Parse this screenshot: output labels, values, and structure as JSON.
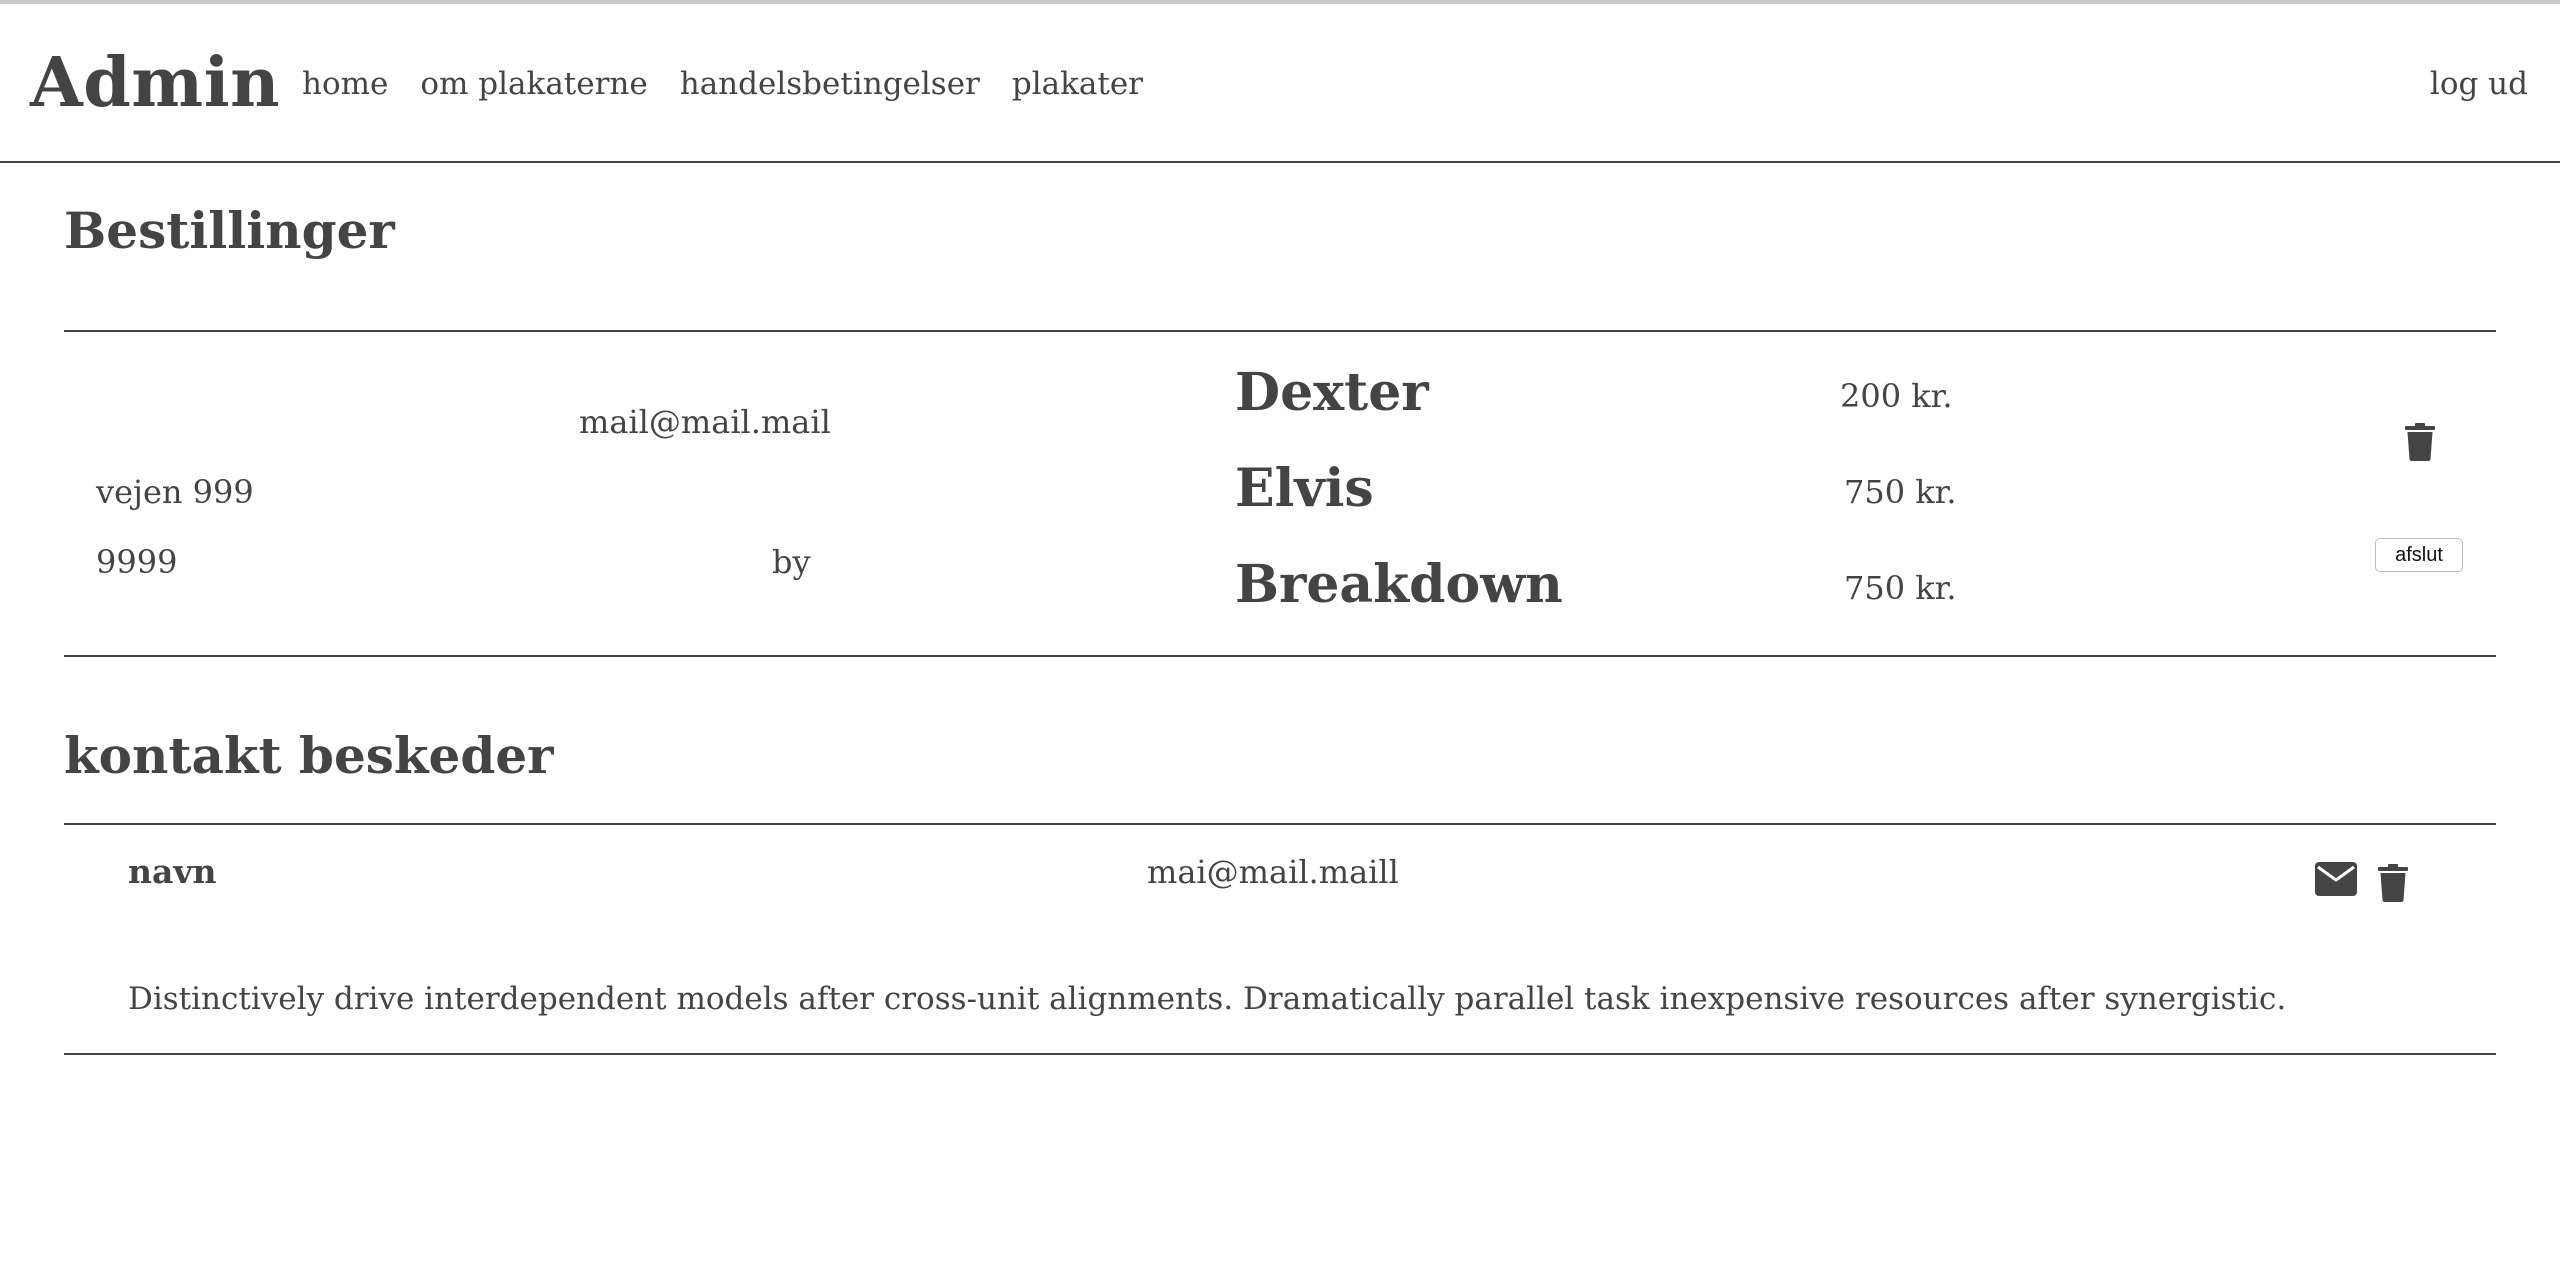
{
  "header": {
    "brand": "Admin",
    "nav": [
      {
        "label": "home"
      },
      {
        "label": "om plakaterne"
      },
      {
        "label": "handelsbetingelser"
      },
      {
        "label": "plakater"
      }
    ],
    "logout": "log ud"
  },
  "orders": {
    "title": "Bestillinger",
    "items": [
      {
        "customer": {
          "email": "mail@mail.mail",
          "address": "vejen 999",
          "zip": "9999",
          "city": "by"
        },
        "products": [
          {
            "name": "Dexter",
            "price": "200 kr."
          },
          {
            "name": "Elvis",
            "price": "750 kr."
          },
          {
            "name": "Breakdown",
            "price": "750 kr."
          }
        ],
        "delete_icon": "trash-icon",
        "complete_label": "afslut"
      }
    ]
  },
  "messages": {
    "title": "kontakt beskeder",
    "items": [
      {
        "name": "navn",
        "email": "mai@mail.maill",
        "body": "Distinctively drive interdependent models after cross-unit alignments. Dramatically parallel task inexpensive resources after synergistic.",
        "reply_icon": "envelope-icon",
        "delete_icon": "trash-icon"
      }
    ]
  },
  "colors": {
    "text": "#444444",
    "rule": "#444444",
    "top_rule": "#c9c9c9",
    "background": "#ffffff"
  }
}
